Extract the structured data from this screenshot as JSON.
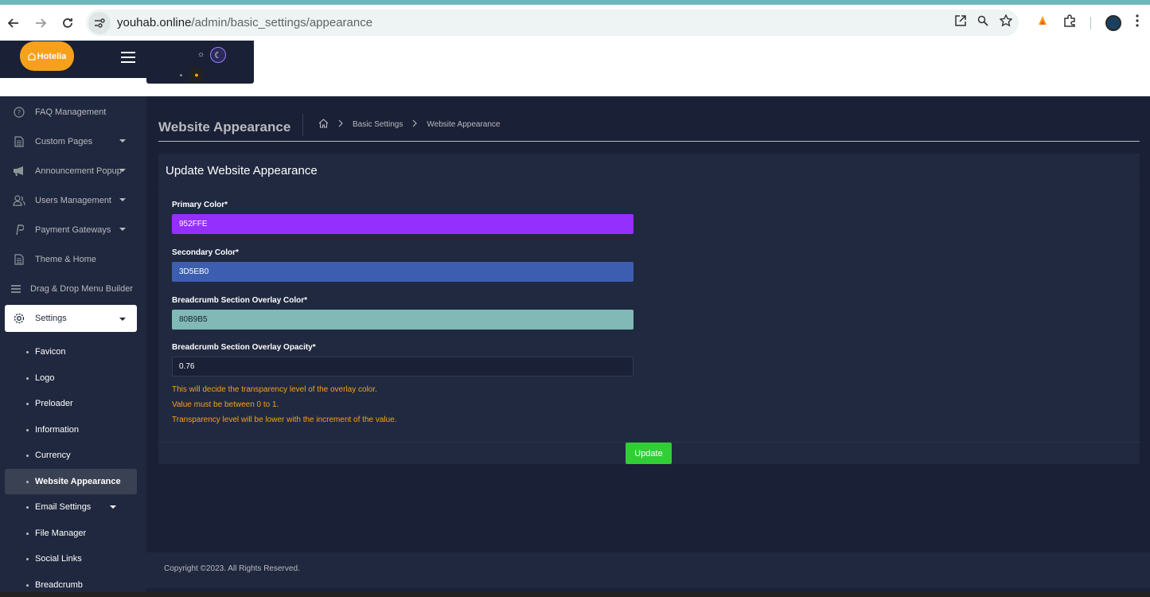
{
  "browser": {
    "url_host": "youhab.online",
    "url_path": "/admin/basic_settings/appearance"
  },
  "header": {
    "logo_text": "Hotelia"
  },
  "sidebar": {
    "items": [
      {
        "label": "FAQ Management",
        "icon": "question-circle-icon"
      },
      {
        "label": "Custom Pages",
        "icon": "file-icon",
        "has_caret": true
      },
      {
        "label": "Announcement Popup",
        "icon": "megaphone-icon",
        "has_caret": true
      },
      {
        "label": "Users Management",
        "icon": "users-icon",
        "has_caret": true
      },
      {
        "label": "Payment Gateways",
        "icon": "paypal-icon",
        "has_caret": true
      },
      {
        "label": "Theme & Home",
        "icon": "file-icon"
      },
      {
        "label": "Drag & Drop Menu Builder",
        "icon": "bars-icon"
      },
      {
        "label": "Settings",
        "icon": "gear-icon",
        "has_caret": true,
        "active": true
      }
    ],
    "sub_items": [
      "Favicon",
      "Logo",
      "Preloader",
      "Information",
      "Currency",
      "Website Appearance",
      "Email Settings",
      "File Manager",
      "Social Links",
      "Breadcrumb"
    ]
  },
  "page": {
    "title": "Website Appearance",
    "breadcrumb": [
      "Basic Settings",
      "Website Appearance"
    ]
  },
  "card": {
    "title": "Update Website Appearance",
    "fields": [
      {
        "label": "Primary Color*",
        "value": "952FFE",
        "color": "#952FFE"
      },
      {
        "label": "Secondary Color*",
        "value": "3D5EB0",
        "color": "#3D5EB0"
      },
      {
        "label": "Breadcrumb Section Overlay Color*",
        "value": "80B9B5",
        "color": "#80B9B5"
      },
      {
        "label": "Breadcrumb Section Overlay Opacity*",
        "value": "0.76"
      }
    ],
    "help": [
      "This will decide the transparency level of the overlay color.",
      "Value must be between 0 to 1.",
      "Transparency level will be lower with the increment of the value."
    ],
    "submit_label": "Update"
  },
  "footer": {
    "text": "Copyright ©2023. All Rights Reserved."
  },
  "colors": {
    "accent": "#f7a01c",
    "success": "#31ce36",
    "sidebar_bg": "#1f283e",
    "main_bg": "#1a2035"
  }
}
